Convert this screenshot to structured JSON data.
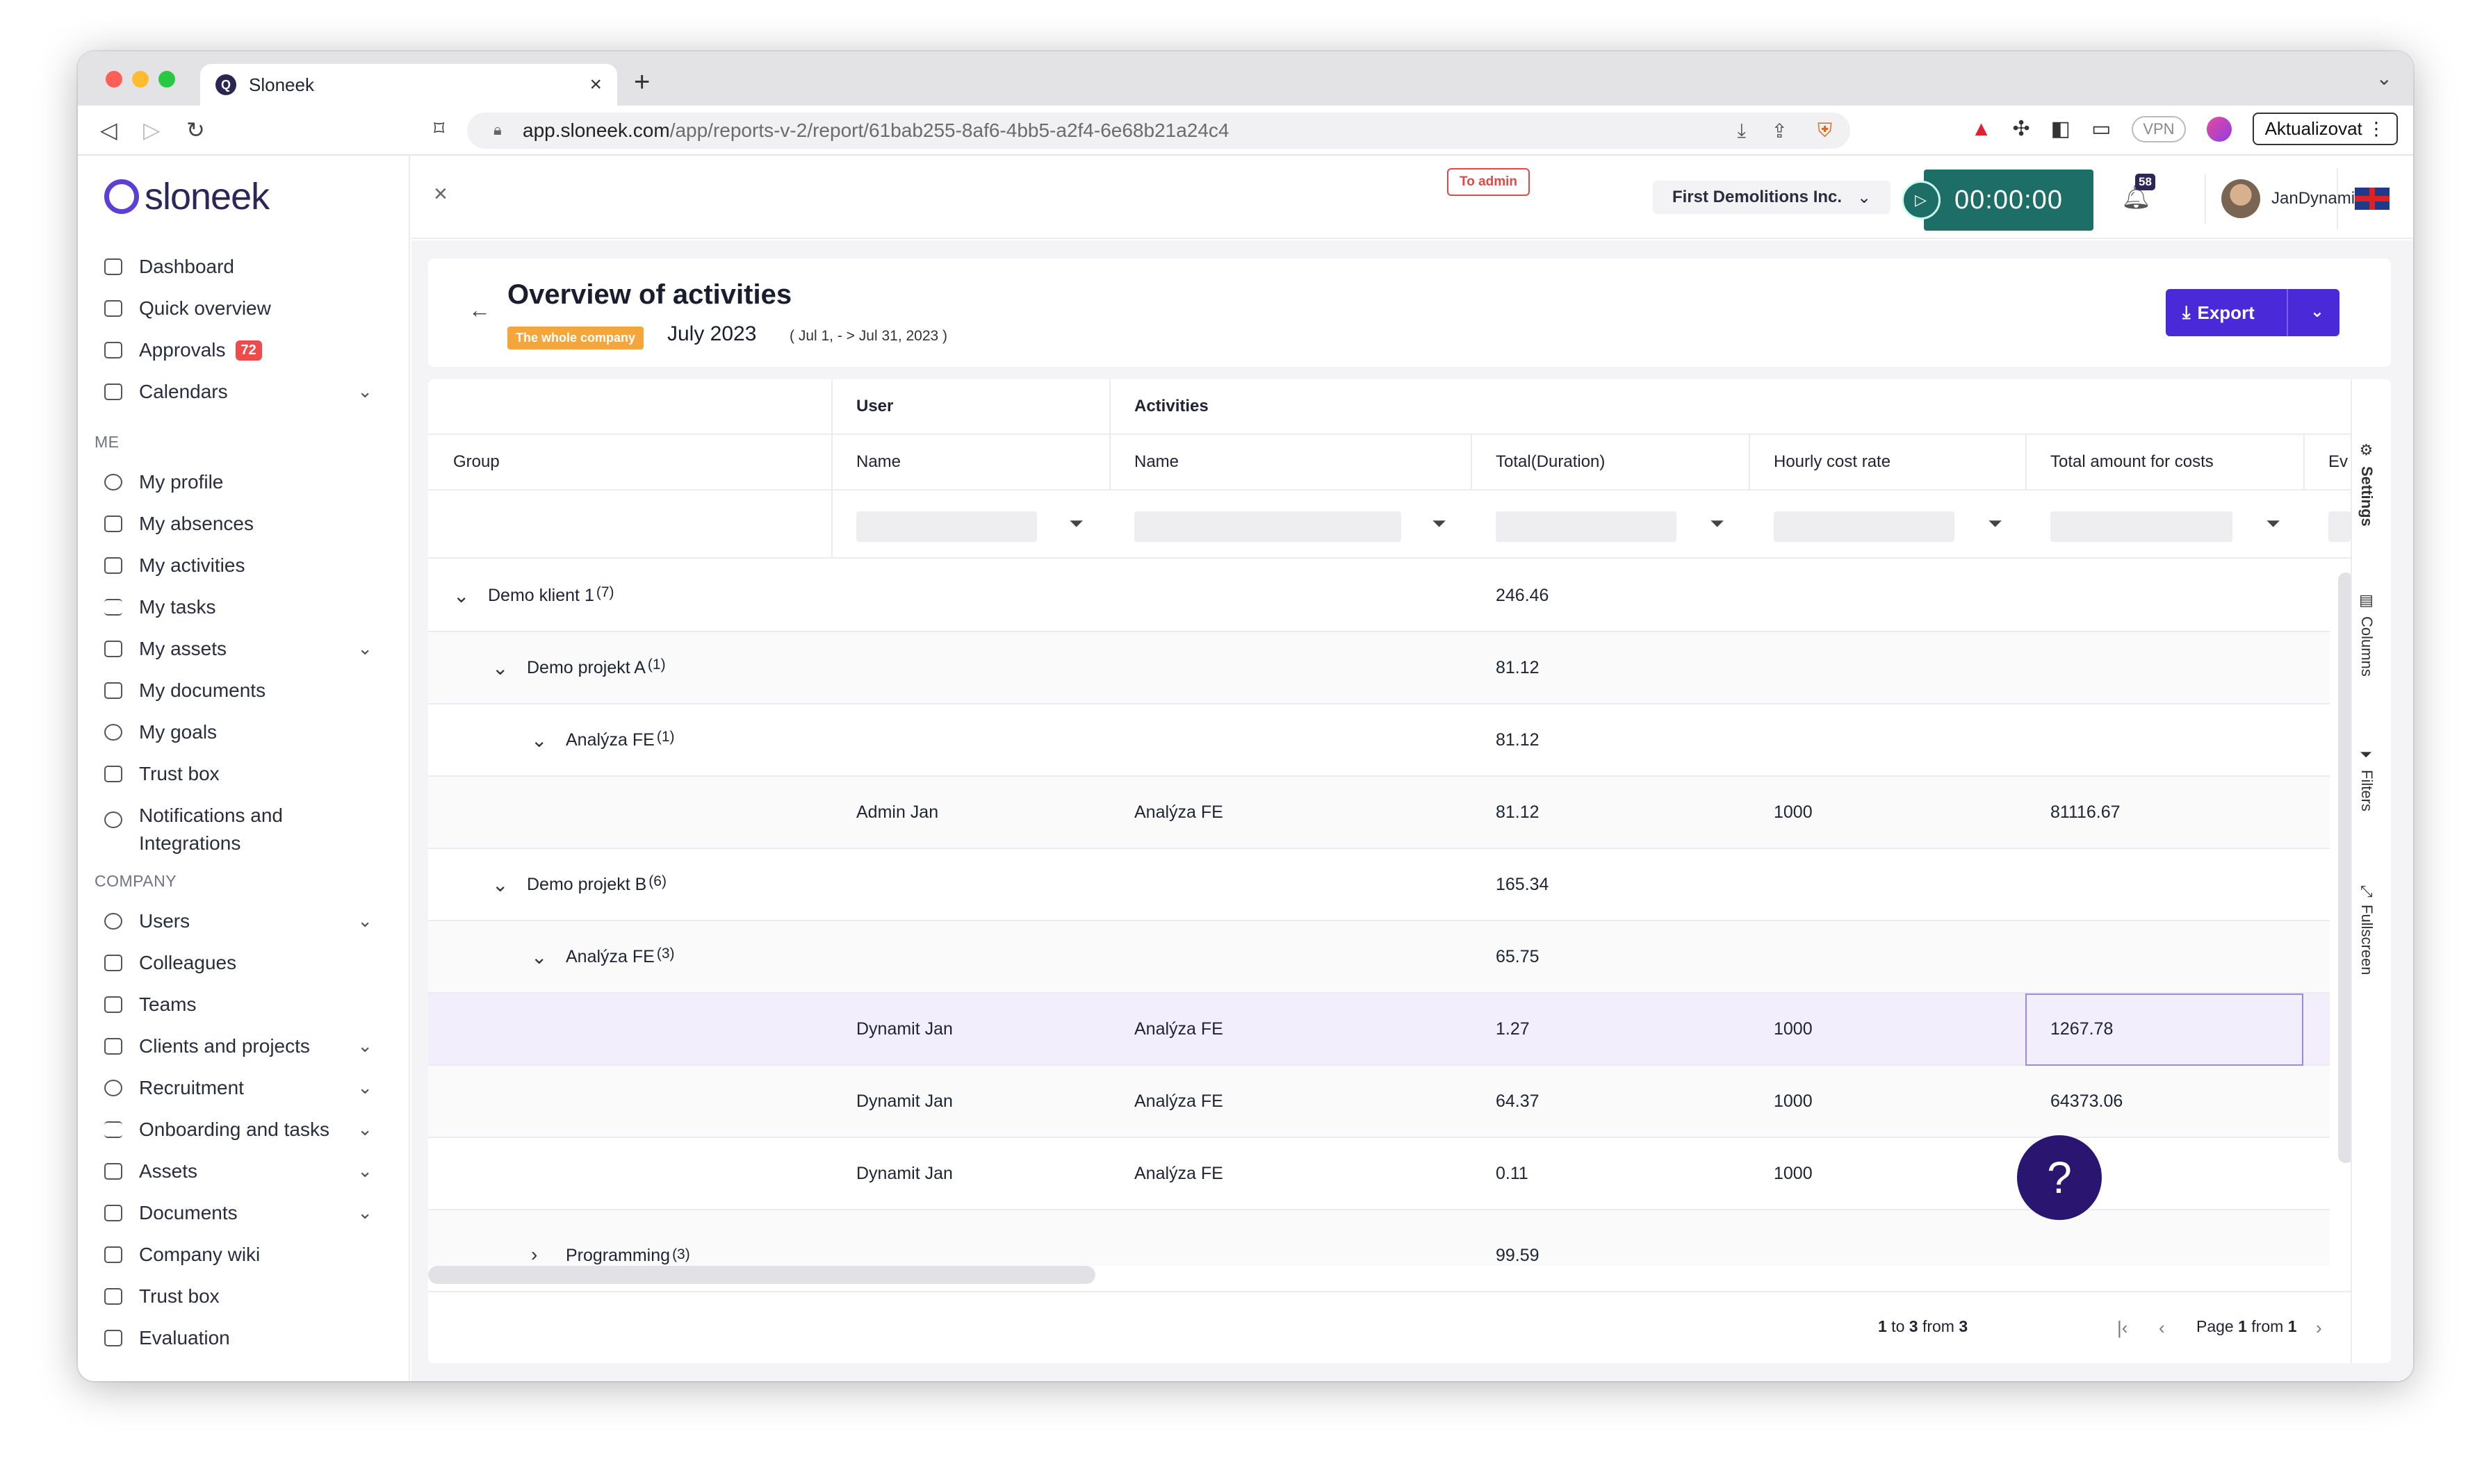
{
  "browser": {
    "tab_title": "Sloneek",
    "url_host": "app.sloneek.com",
    "url_path": "/app/reports-v-2/report/61bab255-8af6-4bb5-a2f4-6e68b21a24c4",
    "vpn_label": "VPN",
    "update_label": "Aktualizovat",
    "shield_count": "1"
  },
  "brand": {
    "name": "sloneek",
    "accent": "#4a2ad8"
  },
  "sidebar": {
    "items_top": [
      {
        "label": "Dashboard"
      },
      {
        "label": "Quick overview"
      },
      {
        "label": "Approvals",
        "badge": "72"
      },
      {
        "label": "Calendars"
      }
    ],
    "section_me": "ME",
    "items_me": [
      {
        "label": "My profile"
      },
      {
        "label": "My absences"
      },
      {
        "label": "My activities"
      },
      {
        "label": "My tasks"
      },
      {
        "label": "My assets"
      },
      {
        "label": "My documents"
      },
      {
        "label": "My goals"
      },
      {
        "label": "Trust box"
      },
      {
        "label": "Notifications and Integrations"
      }
    ],
    "section_company": "COMPANY",
    "items_company": [
      {
        "label": "Users"
      },
      {
        "label": "Colleagues"
      },
      {
        "label": "Teams"
      },
      {
        "label": "Clients and projects"
      },
      {
        "label": "Recruitment"
      },
      {
        "label": "Onboarding and tasks"
      },
      {
        "label": "Assets"
      },
      {
        "label": "Documents"
      },
      {
        "label": "Company wiki"
      },
      {
        "label": "Trust box"
      },
      {
        "label": "Evaluation"
      }
    ]
  },
  "header": {
    "to_admin": "To admin",
    "company": "First Demolitions Inc.",
    "timer": "00:00:00",
    "notifications": "58",
    "user": "JanDynamit"
  },
  "report": {
    "title": "Overview of activities",
    "scope_badge": "The whole company",
    "month": "July 2023",
    "range": "( Jul 1, - > Jul 31, 2023 )",
    "export_label": "Export"
  },
  "grid": {
    "group_headers": {
      "user": "User",
      "activities": "Activities"
    },
    "columns": {
      "group": "Group",
      "user_name": "Name",
      "activity_name": "Name",
      "total_duration": "Total(Duration)",
      "hourly_rate": "Hourly cost rate",
      "total_costs": "Total amount for costs",
      "extra": "Ev"
    },
    "rows": [
      {
        "group": "Demo klient 1",
        "count": "(7)",
        "user": "",
        "activity": "",
        "duration": "246.46",
        "rate": "",
        "cost": ""
      },
      {
        "group": "Demo projekt A",
        "count": "(1)",
        "user": "",
        "activity": "",
        "duration": "81.12",
        "rate": "",
        "cost": ""
      },
      {
        "group": "Analýza FE",
        "count": "(1)",
        "user": "",
        "activity": "",
        "duration": "81.12",
        "rate": "",
        "cost": ""
      },
      {
        "group": "",
        "count": "",
        "user": "Admin Jan",
        "activity": "Analýza FE",
        "duration": "81.12",
        "rate": "1000",
        "cost": "81116.67"
      },
      {
        "group": "Demo projekt B",
        "count": "(6)",
        "user": "",
        "activity": "",
        "duration": "165.34",
        "rate": "",
        "cost": ""
      },
      {
        "group": "Analýza FE",
        "count": "(3)",
        "user": "",
        "activity": "",
        "duration": "65.75",
        "rate": "",
        "cost": ""
      },
      {
        "group": "",
        "count": "",
        "user": "Dynamit Jan",
        "activity": "Analýza FE",
        "duration": "1.27",
        "rate": "1000",
        "cost": "1267.78"
      },
      {
        "group": "",
        "count": "",
        "user": "Dynamit Jan",
        "activity": "Analýza FE",
        "duration": "64.37",
        "rate": "1000",
        "cost": "64373.06"
      },
      {
        "group": "",
        "count": "",
        "user": "Dynamit Jan",
        "activity": "Analýza FE",
        "duration": "0.11",
        "rate": "1000",
        "cost": "112.22"
      },
      {
        "group": "Programming",
        "count": "(3)",
        "user": "",
        "activity": "",
        "duration": "99.59",
        "rate": "",
        "cost": ""
      }
    ],
    "side_panel": [
      "Settings",
      "Columns",
      "Filters",
      "Fullscreen"
    ],
    "footer": {
      "rows_range": "1",
      "rows_to": "3",
      "rows_total": "3",
      "page": "1",
      "page_total": "1"
    }
  },
  "help_label": "?"
}
